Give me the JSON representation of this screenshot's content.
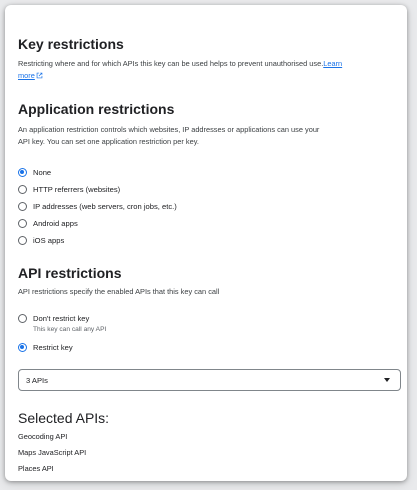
{
  "key_restrictions": {
    "title": "Key restrictions",
    "description": "Restricting where and for which APIs this key can be used helps to prevent unauthorised use.",
    "learn_more_part1": "Learn",
    "learn_more_part2": "more",
    "learn_more_icon": "open-in-new-icon"
  },
  "application_restrictions": {
    "title": "Application restrictions",
    "description_line1": "An application restriction controls which websites, IP addresses or applications can use your",
    "description_line2": "API key. You can set one application restriction per key.",
    "options": [
      {
        "label": "None",
        "checked": true
      },
      {
        "label": "HTTP referrers (websites)",
        "checked": false
      },
      {
        "label": "IP addresses (web servers, cron jobs, etc.)",
        "checked": false
      },
      {
        "label": "Android apps",
        "checked": false
      },
      {
        "label": "iOS apps",
        "checked": false
      }
    ]
  },
  "api_restrictions": {
    "title": "API restrictions",
    "description": "API restrictions specify the enabled APIs that this key can call",
    "options": [
      {
        "label": "Don't restrict key",
        "sublabel": "This key can call any API",
        "checked": false
      },
      {
        "label": "Restrict key",
        "checked": true
      }
    ],
    "select": {
      "value": "3 APIs",
      "icon": "arrow-drop-down-icon"
    }
  },
  "selected_apis": {
    "title": "Selected APIs:",
    "items": [
      "Geocoding API",
      "Maps JavaScript API",
      "Places API"
    ]
  },
  "colors": {
    "accent": "#1a73e8",
    "text": "#202124",
    "secondary_text": "#5f6368"
  }
}
